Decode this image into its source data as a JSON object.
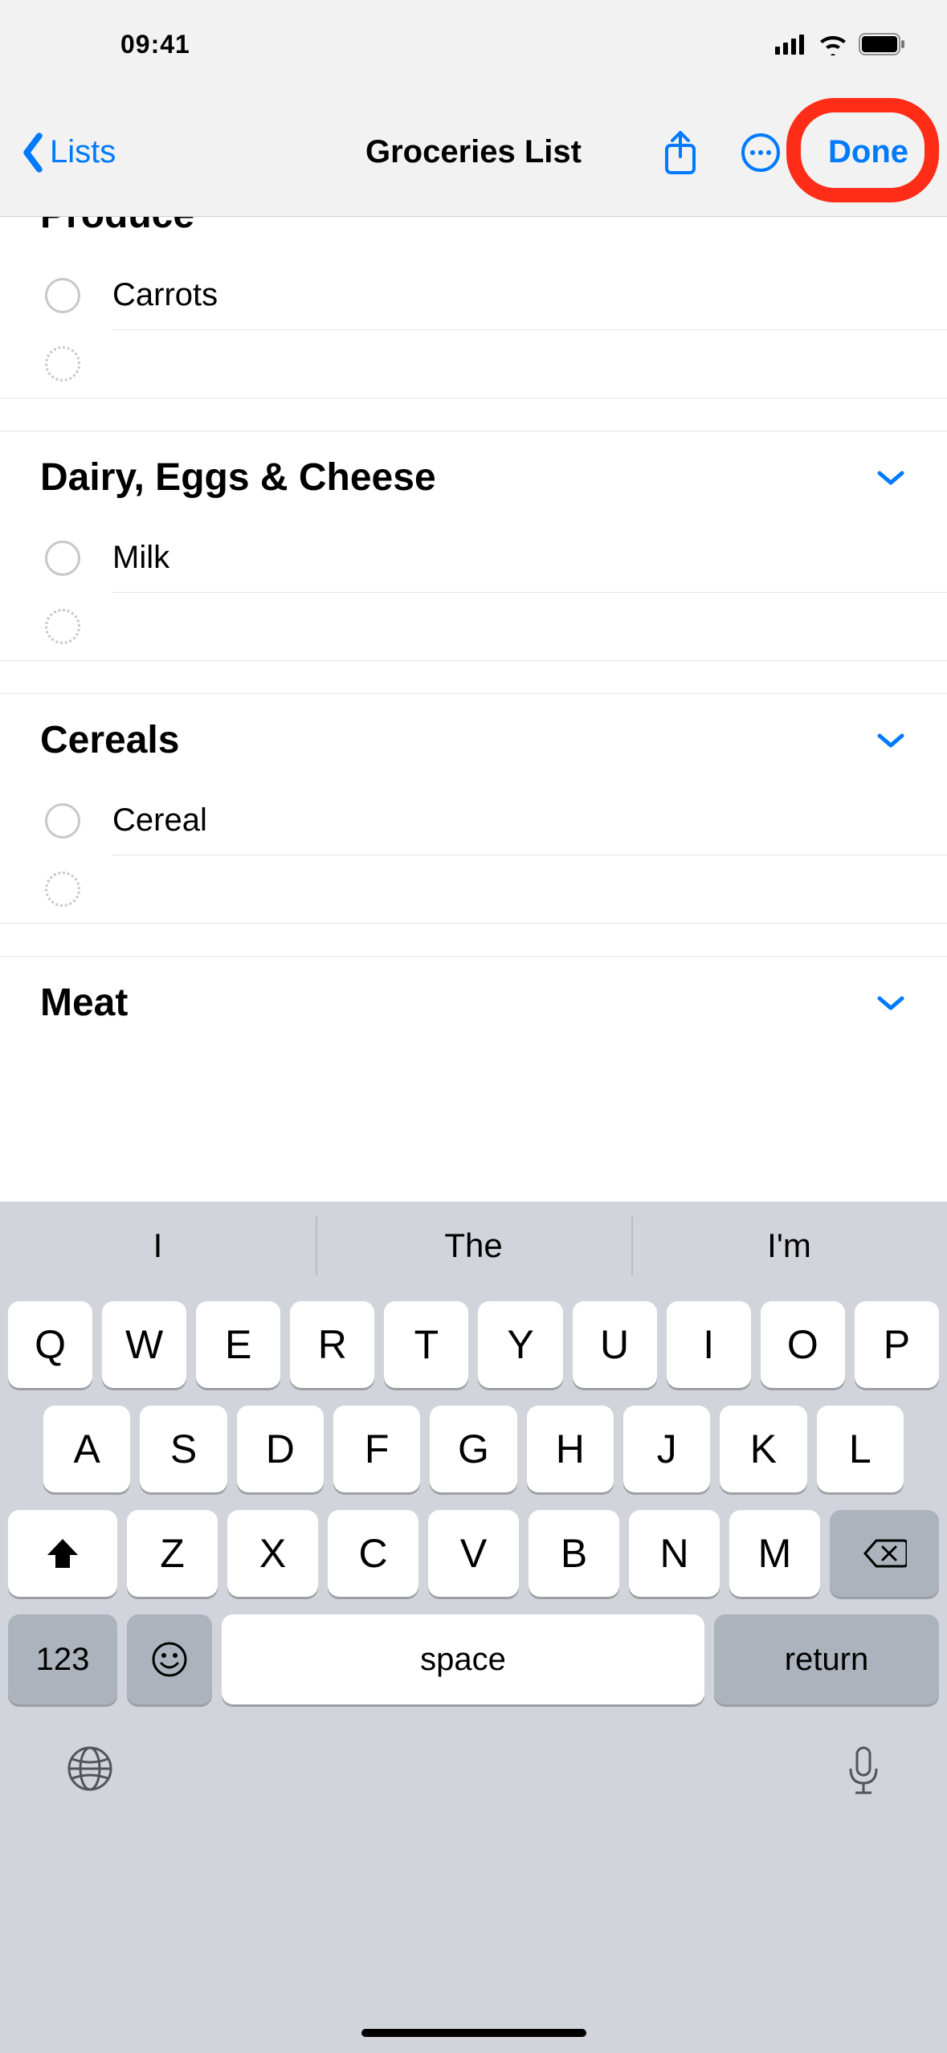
{
  "status": {
    "time": "09:41"
  },
  "nav": {
    "back_label": "Lists",
    "title": "Groceries List",
    "done_label": "Done"
  },
  "sections": [
    {
      "title": "Produce",
      "items": [
        "Carrots"
      ]
    },
    {
      "title": "Dairy, Eggs & Cheese",
      "items": [
        "Milk"
      ]
    },
    {
      "title": "Cereals",
      "items": [
        "Cereal"
      ]
    },
    {
      "title": "Meat",
      "items": []
    }
  ],
  "keyboard": {
    "suggestions": [
      "I",
      "The",
      "I'm"
    ],
    "row1": [
      "Q",
      "W",
      "E",
      "R",
      "T",
      "Y",
      "U",
      "I",
      "O",
      "P"
    ],
    "row2": [
      "A",
      "S",
      "D",
      "F",
      "G",
      "H",
      "J",
      "K",
      "L"
    ],
    "row3": [
      "Z",
      "X",
      "C",
      "V",
      "B",
      "N",
      "M"
    ],
    "num_label": "123",
    "space_label": "space",
    "return_label": "return"
  }
}
